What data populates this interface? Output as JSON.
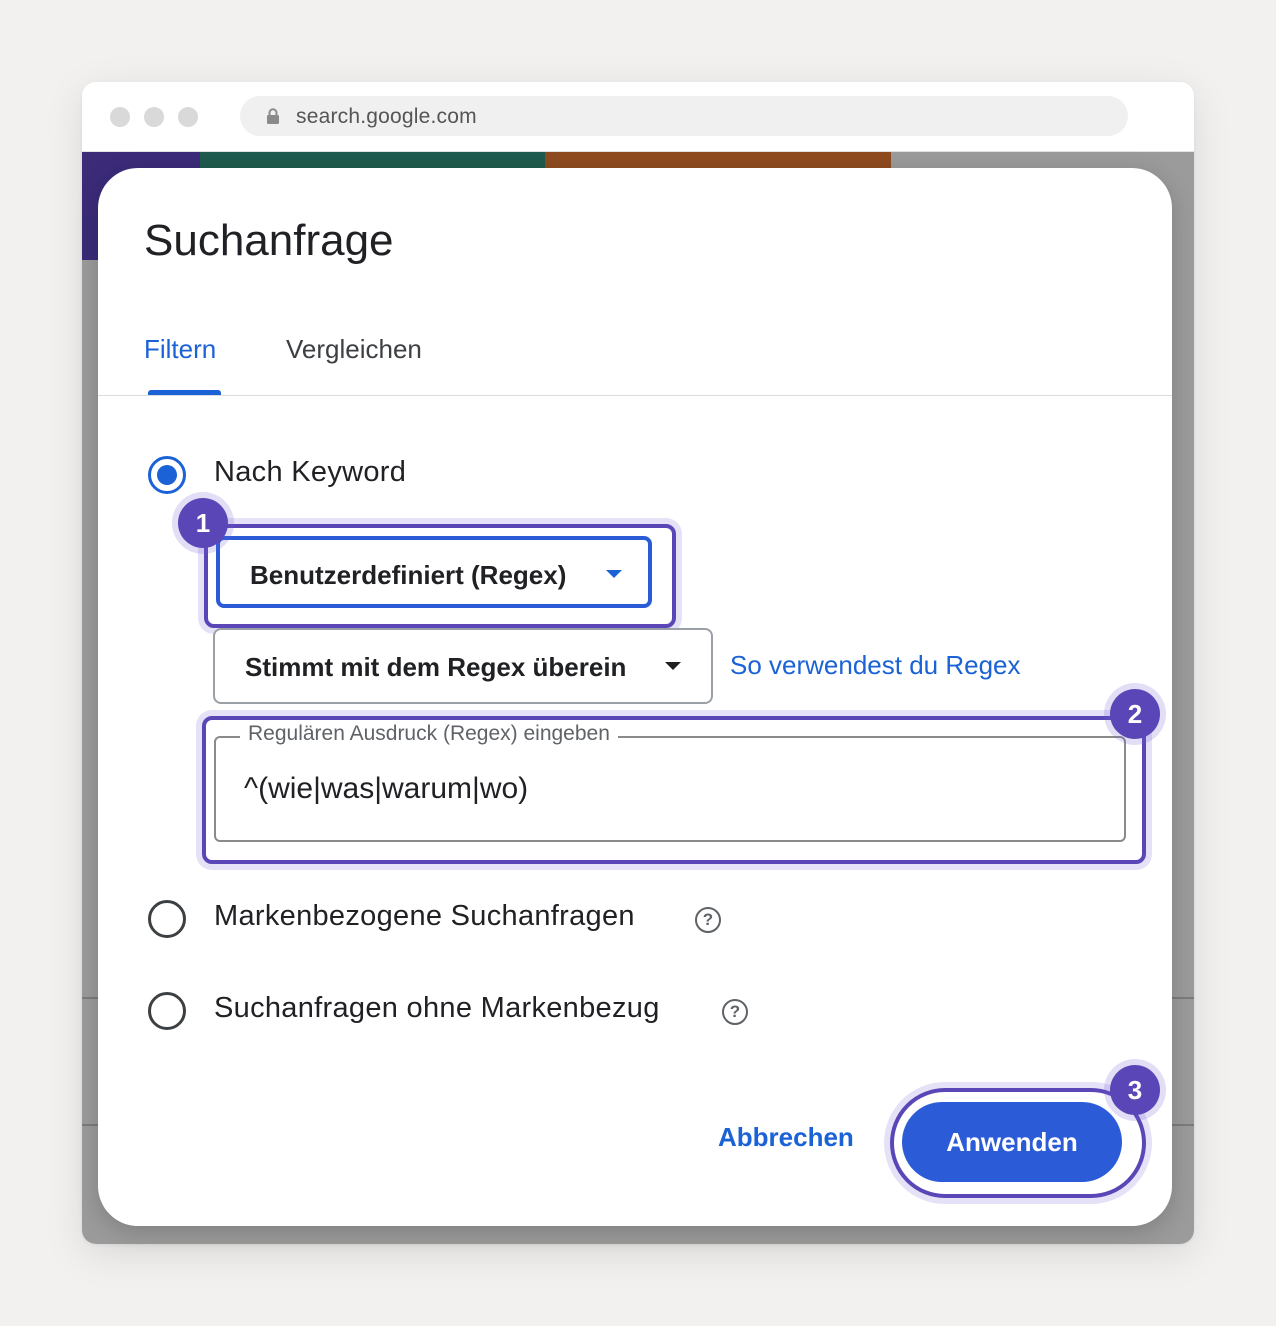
{
  "browser": {
    "url": "search.google.com"
  },
  "dialog": {
    "title": "Suchanfrage",
    "tabs": [
      {
        "label": "Filtern",
        "active": true
      },
      {
        "label": "Vergleichen",
        "active": false
      }
    ],
    "options": [
      {
        "label": "Nach Keyword",
        "checked": true
      },
      {
        "label": "Markenbezogene Suchanfragen",
        "checked": false
      },
      {
        "label": "Suchanfragen ohne Markenbezug",
        "checked": false
      }
    ],
    "keyword_type_select": {
      "value": "Benutzerdefiniert (Regex)"
    },
    "match_select": {
      "value": "Stimmt mit dem Regex überein"
    },
    "regex_help_link": "So verwendest du Regex",
    "regex_field": {
      "label": "Regulären Ausdruck (Regex) eingeben",
      "value": "^(wie|was|warum|wo)"
    },
    "cancel_label": "Abbrechen",
    "apply_label": "Anwenden"
  },
  "annotations": {
    "step_1": "1",
    "step_2": "2",
    "step_3": "3",
    "accent_color": "#5b46b8"
  },
  "colors": {
    "primary_blue": "#1a62d6",
    "apply_button": "#2b5bd6"
  },
  "icons": {
    "help": "?"
  }
}
